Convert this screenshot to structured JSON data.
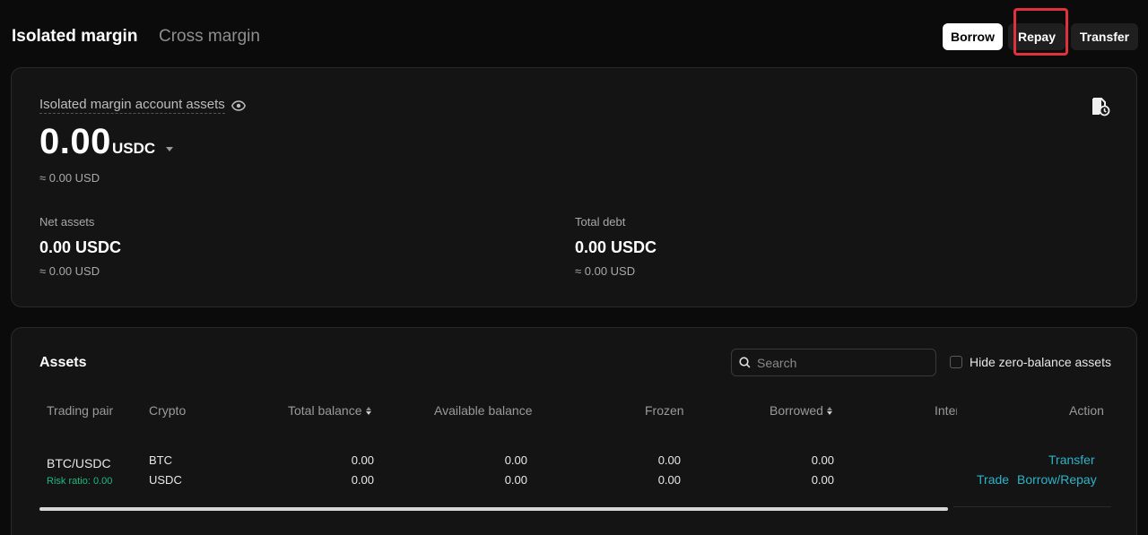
{
  "header": {
    "tabs": [
      {
        "label": "Isolated margin",
        "active": true
      },
      {
        "label": "Cross margin",
        "active": false
      }
    ],
    "buttons": {
      "borrow": "Borrow",
      "repay": "Repay",
      "transfer": "Transfer"
    }
  },
  "summary": {
    "title": "Isolated margin account assets",
    "total_value": "0.00",
    "currency": "USDC",
    "total_usd": "≈ 0.00 USD",
    "net_assets": {
      "label": "Net assets",
      "value": "0.00 USDC",
      "usd": "≈ 0.00 USD"
    },
    "total_debt": {
      "label": "Total debt",
      "value": "0.00 USDC",
      "usd": "≈ 0.00 USD"
    }
  },
  "assets": {
    "title": "Assets",
    "search_placeholder": "Search",
    "hide_zero_label": "Hide zero-balance assets",
    "columns": [
      "Trading pair",
      "Crypto",
      "Total balance",
      "Available balance",
      "Frozen",
      "Borrowed",
      "Inter",
      "Action"
    ],
    "rows": [
      {
        "pair": "BTC/USDC",
        "risk": "Risk ratio: 0.00",
        "cryptos": [
          {
            "crypto": "BTC",
            "total": "0.00",
            "available": "0.00",
            "frozen": "0.00",
            "borrowed": "0.00"
          },
          {
            "crypto": "USDC",
            "total": "0.00",
            "available": "0.00",
            "frozen": "0.00",
            "borrowed": "0.00"
          }
        ],
        "actions": {
          "transfer": "Transfer",
          "trade": "Trade",
          "borrow_repay": "Borrow/Repay"
        }
      }
    ]
  },
  "colors": {
    "accent_link": "#2eb3c8",
    "risk_green": "#1fb980",
    "highlight": "#e0323a"
  }
}
